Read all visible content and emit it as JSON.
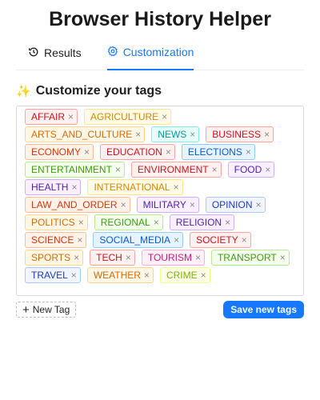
{
  "app": {
    "title": "Browser History Helper"
  },
  "tabs": [
    {
      "label": "Results",
      "icon": "history-icon",
      "active": false
    },
    {
      "label": "Customization",
      "icon": "settings-icon",
      "active": true
    }
  ],
  "section": {
    "icon": "sparkles-icon",
    "heading": "Customize your tags"
  },
  "tags": [
    {
      "label": "AFFAIR",
      "color": "red"
    },
    {
      "label": "AGRICULTURE",
      "color": "gold"
    },
    {
      "label": "ARTS_AND_CULTURE",
      "color": "orange"
    },
    {
      "label": "NEWS",
      "color": "cyan"
    },
    {
      "label": "BUSINESS",
      "color": "red"
    },
    {
      "label": "ECONOMY",
      "color": "volcano"
    },
    {
      "label": "EDUCATION",
      "color": "red"
    },
    {
      "label": "ELECTIONS",
      "color": "blue"
    },
    {
      "label": "ENTERTAINMENT",
      "color": "green"
    },
    {
      "label": "ENVIRONMENT",
      "color": "red"
    },
    {
      "label": "FOOD",
      "color": "purple"
    },
    {
      "label": "HEALTH",
      "color": "purple"
    },
    {
      "label": "INTERNATIONAL",
      "color": "gold"
    },
    {
      "label": "LAW_AND_ORDER",
      "color": "volcano"
    },
    {
      "label": "MILITARY",
      "color": "purple"
    },
    {
      "label": "OPINION",
      "color": "geekblue"
    },
    {
      "label": "POLITICS",
      "color": "orange"
    },
    {
      "label": "REGIONAL",
      "color": "green"
    },
    {
      "label": "RELIGION",
      "color": "purple"
    },
    {
      "label": "SCIENCE",
      "color": "volcano"
    },
    {
      "label": "SOCIAL_MEDIA",
      "color": "blue"
    },
    {
      "label": "SOCIETY",
      "color": "red"
    },
    {
      "label": "SPORTS",
      "color": "orange"
    },
    {
      "label": "TECH",
      "color": "red"
    },
    {
      "label": "TOURISM",
      "color": "magenta"
    },
    {
      "label": "TRANSPORT",
      "color": "green"
    },
    {
      "label": "TRAVEL",
      "color": "geekblue"
    },
    {
      "label": "WEATHER",
      "color": "orange"
    },
    {
      "label": "CRIME",
      "color": "lime"
    }
  ],
  "actions": {
    "new_tag_label": "New Tag",
    "save_label": "Save new tags"
  },
  "colors": {
    "accent": "#1677ff"
  }
}
